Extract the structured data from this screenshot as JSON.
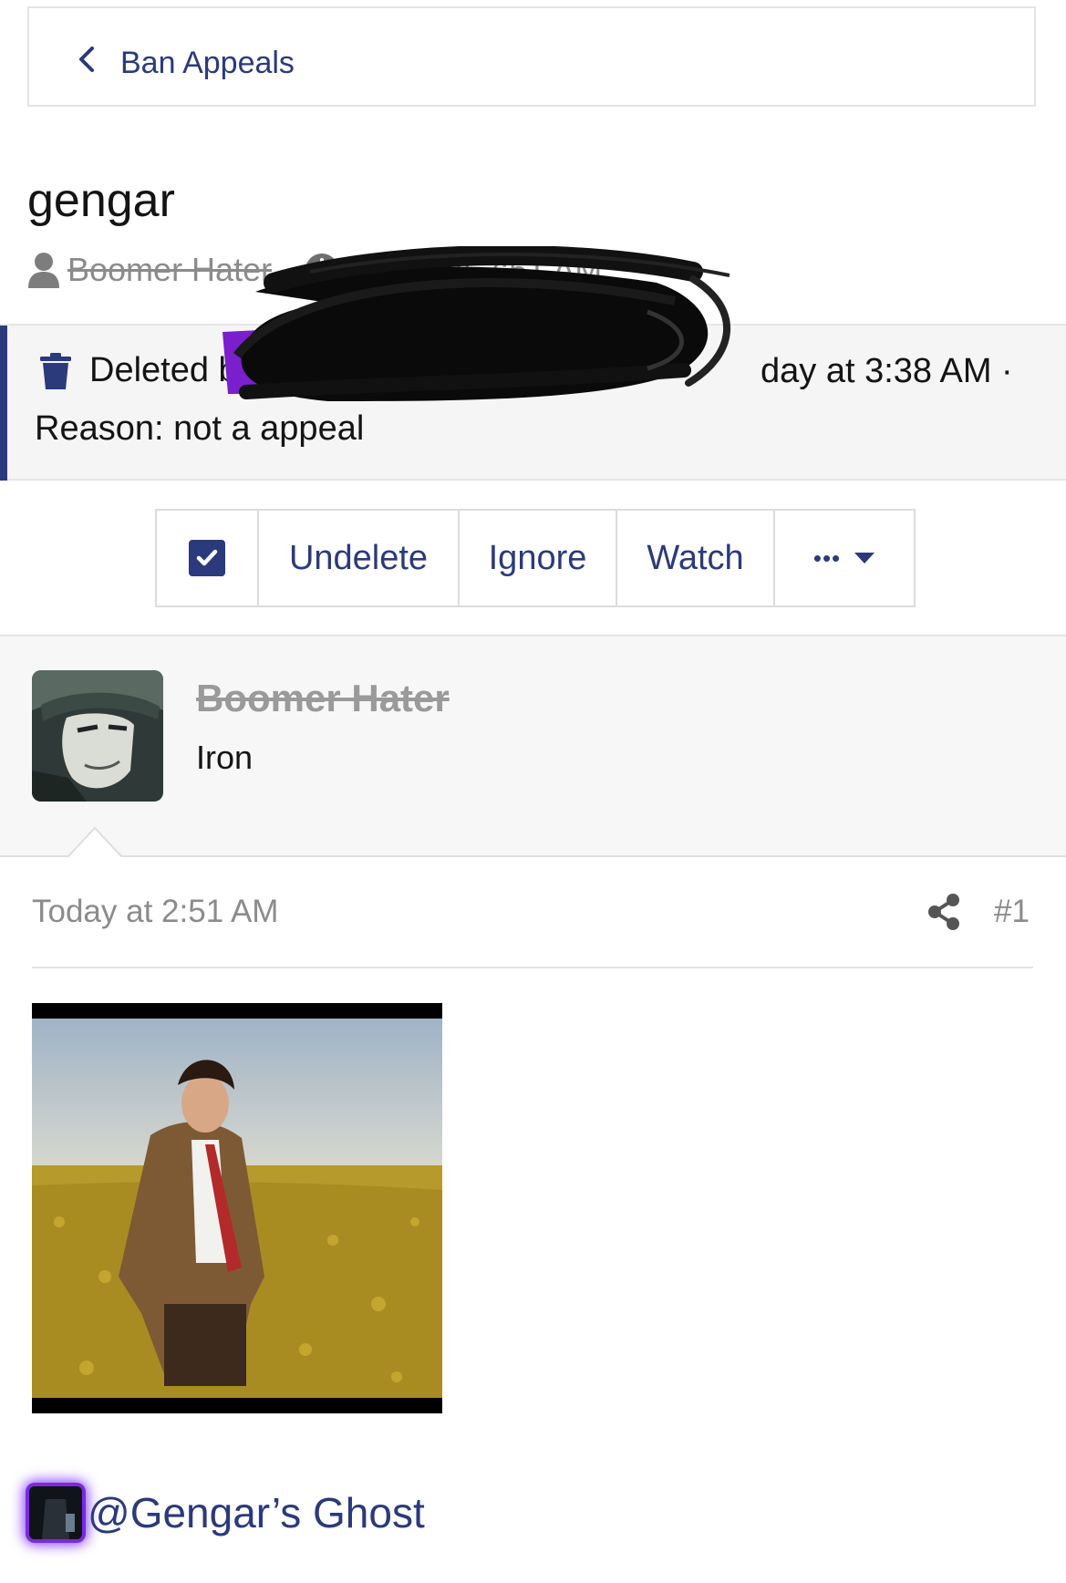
{
  "breadcrumb": {
    "label": "Ban Appeals"
  },
  "thread": {
    "title": "gengar",
    "author": "Boomer Hater",
    "separator": "·",
    "time": "Today at 2:51 AM"
  },
  "deleted": {
    "prefix": "Deleted by",
    "time_suffix": "day at 3:38 AM ·",
    "reason": "Reason: not a appeal"
  },
  "toolbar": {
    "undelete": "Undelete",
    "ignore": "Ignore",
    "watch": "Watch",
    "more": "•••"
  },
  "post": {
    "username": "Boomer Hater",
    "user_title": "Iron",
    "date": "Today at 2:51 AM",
    "number": "#1",
    "mention": "@Gengar’s Ghost"
  },
  "colors": {
    "accent": "#2b3a7a",
    "muted": "#8b8b8b",
    "redaction_purple": "#7a1fcc"
  },
  "icons": {
    "back": "chevron-left-icon",
    "user": "user-icon",
    "clock": "clock-icon",
    "trash": "trash-icon",
    "check": "checkbox-checked-icon",
    "caret": "caret-down-icon",
    "share": "share-icon"
  }
}
